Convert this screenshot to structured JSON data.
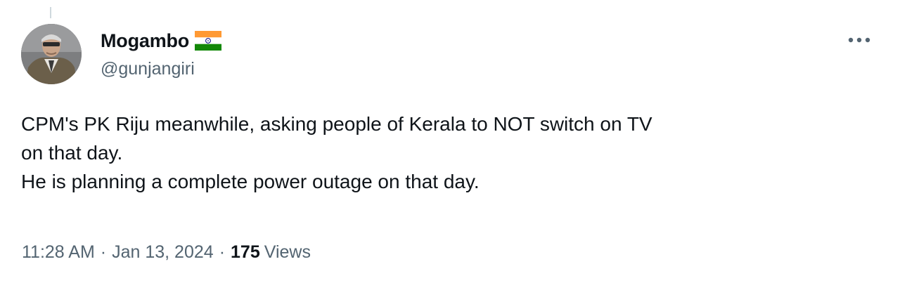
{
  "tweet": {
    "author": {
      "display_name": "Mogambo",
      "handle": "@gunjangiri",
      "flag_icon": "india-flag-icon",
      "avatar": "avatar"
    },
    "text_lines": [
      "CPM's PK Riju meanwhile, asking people of Kerala to NOT switch on TV",
      "on that day.",
      "He is planning a complete power outage on that day."
    ],
    "time": "11:28 AM",
    "separator": "·",
    "date": "Jan 13, 2024",
    "views_count": "175",
    "views_label": "Views"
  },
  "colors": {
    "text_primary": "#0f1419",
    "text_secondary": "#536471",
    "flag_saffron": "#ff9933",
    "flag_green": "#138808",
    "flag_chakra": "#000080"
  }
}
